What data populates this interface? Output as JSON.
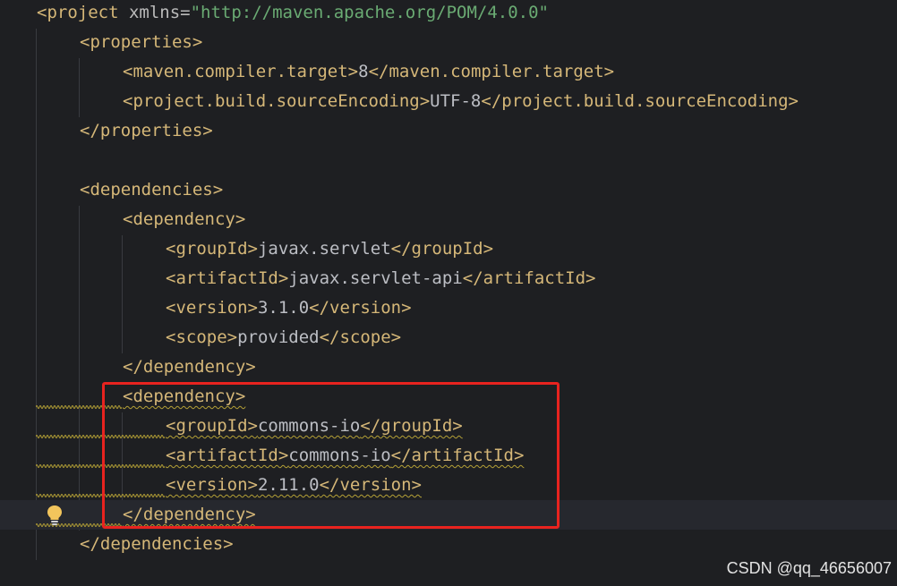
{
  "editor": {
    "language": "xml",
    "lines": [
      {
        "indent": 0,
        "parts": [
          {
            "t": "tag",
            "v": "<project "
          },
          {
            "t": "attr",
            "v": "xmlns="
          },
          {
            "t": "str",
            "v": "\"http://maven.apache.org/POM/4.0.0\""
          }
        ]
      },
      {
        "indent": 1,
        "parts": [
          {
            "t": "tag",
            "v": "<properties>"
          }
        ]
      },
      {
        "indent": 2,
        "parts": [
          {
            "t": "tag",
            "v": "<maven.compiler.target>"
          },
          {
            "t": "txt",
            "v": "8"
          },
          {
            "t": "tag",
            "v": "</maven.compiler.target>"
          }
        ]
      },
      {
        "indent": 2,
        "parts": [
          {
            "t": "tag",
            "v": "<project.build.sourceEncoding>"
          },
          {
            "t": "txt",
            "v": "UTF-8"
          },
          {
            "t": "tag",
            "v": "</project.build.sourceEncoding>"
          }
        ]
      },
      {
        "indent": 1,
        "parts": [
          {
            "t": "tag",
            "v": "</properties>"
          }
        ]
      },
      {
        "indent": 0,
        "parts": []
      },
      {
        "indent": 1,
        "parts": [
          {
            "t": "tag",
            "v": "<dependencies>"
          }
        ]
      },
      {
        "indent": 2,
        "parts": [
          {
            "t": "tag",
            "v": "<dependency>"
          }
        ]
      },
      {
        "indent": 3,
        "parts": [
          {
            "t": "tag",
            "v": "<groupId>"
          },
          {
            "t": "txt",
            "v": "javax.servlet"
          },
          {
            "t": "tag",
            "v": "</groupId>"
          }
        ]
      },
      {
        "indent": 3,
        "parts": [
          {
            "t": "tag",
            "v": "<artifactId>"
          },
          {
            "t": "txt",
            "v": "javax.servlet-api"
          },
          {
            "t": "tag",
            "v": "</artifactId>"
          }
        ]
      },
      {
        "indent": 3,
        "parts": [
          {
            "t": "tag",
            "v": "<version>"
          },
          {
            "t": "txt",
            "v": "3.1.0"
          },
          {
            "t": "tag",
            "v": "</version>"
          }
        ]
      },
      {
        "indent": 3,
        "parts": [
          {
            "t": "tag",
            "v": "<scope>"
          },
          {
            "t": "txt",
            "v": "provided"
          },
          {
            "t": "tag",
            "v": "</scope>"
          }
        ]
      },
      {
        "indent": 2,
        "parts": [
          {
            "t": "tag",
            "v": "</dependency>"
          }
        ]
      },
      {
        "indent": 2,
        "squiggle": true,
        "parts": [
          {
            "t": "tag",
            "v": "<dependency>"
          }
        ]
      },
      {
        "indent": 3,
        "squiggle": true,
        "parts": [
          {
            "t": "tag",
            "v": "<groupId>"
          },
          {
            "t": "txt",
            "v": "commons-io"
          },
          {
            "t": "tag",
            "v": "</groupId>"
          }
        ]
      },
      {
        "indent": 3,
        "squiggle": true,
        "parts": [
          {
            "t": "tag",
            "v": "<artifactId>"
          },
          {
            "t": "txt",
            "v": "commons-io"
          },
          {
            "t": "tag",
            "v": "</artifactId>"
          }
        ]
      },
      {
        "indent": 3,
        "squiggle": true,
        "parts": [
          {
            "t": "tag",
            "v": "<version>"
          },
          {
            "t": "txt",
            "v": "2.11.0"
          },
          {
            "t": "tag",
            "v": "</version>"
          }
        ]
      },
      {
        "indent": 2,
        "squiggle": true,
        "current": true,
        "bulb": true,
        "parts": [
          {
            "t": "tag",
            "v": "</dependency>"
          }
        ]
      },
      {
        "indent": 1,
        "parts": [
          {
            "t": "tag",
            "v": "</dependencies>"
          }
        ]
      }
    ]
  },
  "icons": {
    "intention_bulb": "lightbulb-icon"
  },
  "colors": {
    "background": "#1e1f22",
    "tag": "#d5b778",
    "string": "#6aab73",
    "text": "#bcbec4",
    "warning_squiggle": "#b5a136",
    "annotation_box": "#e8231f"
  },
  "watermark": {
    "text": "CSDN @qq_46656007"
  }
}
